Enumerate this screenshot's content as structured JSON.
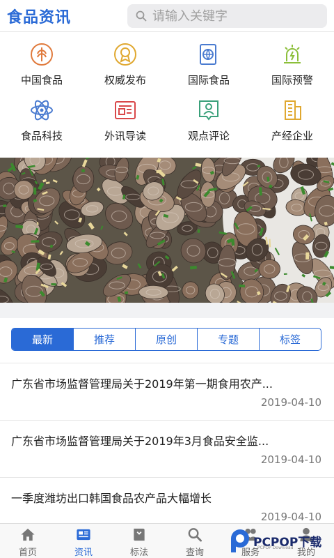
{
  "header": {
    "logo": "食品资讯",
    "search_placeholder": "请输入关键字"
  },
  "categories": [
    {
      "label": "中国食品",
      "icon": "wheat-icon",
      "color": "#e07a3c"
    },
    {
      "label": "权威发布",
      "icon": "badge-icon",
      "color": "#e0a830"
    },
    {
      "label": "国际食品",
      "icon": "globe-book-icon",
      "color": "#4a7bd0"
    },
    {
      "label": "国际预警",
      "icon": "alarm-icon",
      "color": "#8cbf3a"
    },
    {
      "label": "食品科技",
      "icon": "atom-icon",
      "color": "#4a7bd0"
    },
    {
      "label": "外讯导读",
      "icon": "newspaper-icon",
      "color": "#d9484a"
    },
    {
      "label": "观点评论",
      "icon": "comment-user-icon",
      "color": "#3aa07a"
    },
    {
      "label": "产经企业",
      "icon": "building-icon",
      "color": "#e0a830"
    }
  ],
  "tabs": [
    "最新",
    "推荐",
    "原创",
    "专题",
    "标签"
  ],
  "active_tab": 0,
  "news": [
    {
      "title": "广东省市场监督管理局关于2019年第一期食用农产...",
      "date": "2019-04-10"
    },
    {
      "title": "广东省市场监督管理局关于2019年3月食品安全监...",
      "date": "2019-04-10"
    },
    {
      "title": "一季度潍坊出口韩国食品农产品大幅增长",
      "date": "2019-04-10"
    }
  ],
  "bottom_nav": [
    {
      "label": "首页",
      "icon": "home-icon"
    },
    {
      "label": "资讯",
      "icon": "news-icon"
    },
    {
      "label": "标法",
      "icon": "book-icon"
    },
    {
      "label": "查询",
      "icon": "search-icon"
    },
    {
      "label": "服务",
      "icon": "service-icon"
    },
    {
      "label": "我的",
      "icon": "user-icon"
    }
  ],
  "active_nav": 1,
  "accent_color": "#2a6ad6",
  "watermark": {
    "brand": "PCPOP下载",
    "sub": "PCPOP Download"
  }
}
